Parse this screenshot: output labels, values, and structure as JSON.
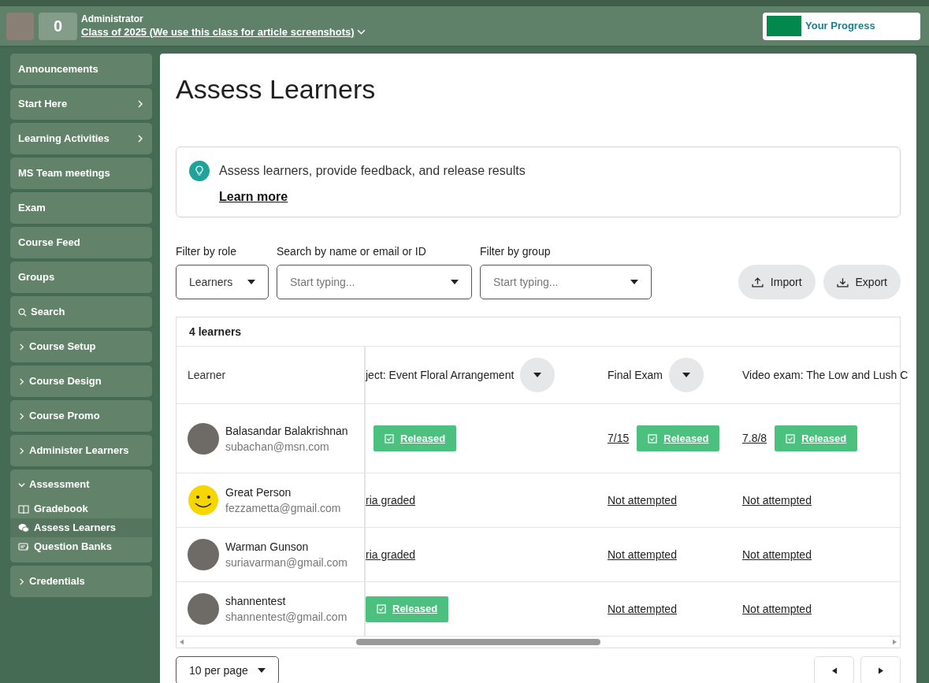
{
  "header": {
    "points": "0",
    "role": "Administrator",
    "class_name": "Class of 2025 (We use this class for article screenshots)",
    "progress_label": "Your Progress"
  },
  "sidebar": {
    "items": [
      {
        "kind": "plain",
        "label": "Announcements"
      },
      {
        "kind": "trailing",
        "label": "Start Here"
      },
      {
        "kind": "trailing",
        "label": "Learning Activities"
      },
      {
        "kind": "plain",
        "label": "MS Team meetings"
      },
      {
        "kind": "plain",
        "label": "Exam"
      },
      {
        "kind": "plain",
        "label": "Course Feed"
      },
      {
        "kind": "plain",
        "label": "Groups"
      },
      {
        "kind": "search",
        "label": "Search"
      },
      {
        "kind": "section",
        "label": "Course Setup",
        "expanded": false
      },
      {
        "kind": "section",
        "label": "Course Design",
        "expanded": false
      },
      {
        "kind": "section",
        "label": "Course Promo",
        "expanded": false
      },
      {
        "kind": "section",
        "label": "Administer Learners",
        "expanded": false
      },
      {
        "kind": "section",
        "label": "Assessment",
        "expanded": true,
        "children": [
          {
            "label": "Gradebook",
            "selected": false
          },
          {
            "label": "Assess Learners",
            "selected": true
          },
          {
            "label": "Question Banks",
            "selected": false
          }
        ]
      },
      {
        "kind": "section",
        "label": "Credentials",
        "expanded": false
      }
    ]
  },
  "page": {
    "title": "Assess Learners",
    "info": {
      "text": "Assess learners, provide feedback, and release results",
      "link": "Learn more"
    },
    "filters": [
      {
        "label": "Filter by role",
        "value": "Learners"
      },
      {
        "label": "Search by name or email or ID",
        "placeholder": "Start typing..."
      },
      {
        "label": "Filter by group",
        "placeholder": "Start typing..."
      }
    ],
    "actions": [
      {
        "label": "Import"
      },
      {
        "label": "Export"
      }
    ]
  },
  "table": {
    "count": "4 learners",
    "learner_heading": "Learner",
    "columns": [
      {
        "label": "ject: Event Floral Arrangement",
        "has_menu": true
      },
      {
        "label": "Final Exam",
        "has_menu": true
      },
      {
        "label": "Video exam: The Low and Lush C",
        "has_menu": false
      }
    ],
    "rows": [
      {
        "name": "Balasandar Balakrishnan",
        "email": "subachan@msn.com",
        "kind": "photo",
        "cells": [
          {
            "kind": "released",
            "label": "Released"
          },
          {
            "kind": "released",
            "score": "7/15",
            "label": "Released"
          },
          {
            "kind": "released",
            "score": "7.8/8",
            "label": "Released"
          }
        ]
      },
      {
        "name": "Great Person",
        "email": "fezzametta@gmail.com",
        "kind": "smiley",
        "cells": [
          {
            "kind": "link",
            "label": "ria graded"
          },
          {
            "kind": "link",
            "label": "Not attempted"
          },
          {
            "kind": "link",
            "label": "Not attempted"
          }
        ]
      },
      {
        "name": "Warman Gunson",
        "email": "suriavarman@gmail.com",
        "kind": "photo",
        "cells": [
          {
            "kind": "link",
            "label": "ria graded"
          },
          {
            "kind": "link",
            "label": "Not attempted"
          },
          {
            "kind": "link",
            "label": "Not attempted"
          }
        ]
      },
      {
        "name": "shannentest",
        "email": "shannentest@gmail.com",
        "kind": "photo",
        "cells": [
          {
            "kind": "released",
            "label": "Released"
          },
          {
            "kind": "link",
            "label": "Not attempted"
          },
          {
            "kind": "link",
            "label": "Not attempted"
          }
        ]
      }
    ]
  },
  "pagination": {
    "per_page": "10 per page"
  }
}
